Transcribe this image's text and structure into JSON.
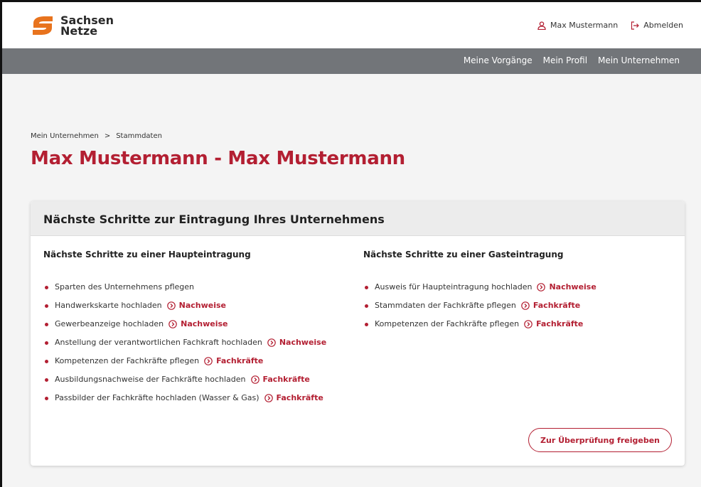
{
  "brand": {
    "line1": "Sachsen",
    "line2": "Netze",
    "colors": {
      "orange": "#e8731d",
      "red": "#b31f32"
    }
  },
  "user": {
    "name": "Max Mustermann",
    "logout": "Abmelden"
  },
  "nav": {
    "items": [
      "Meine Vorgänge",
      "Mein Profil",
      "Mein Unternehmen"
    ]
  },
  "breadcrumb": {
    "parent": "Mein Unternehmen",
    "separator": ">",
    "current": "Stammdaten"
  },
  "page": {
    "title": "Max Mustermann - Max Mustermann"
  },
  "card": {
    "title": "Nächste Schritte zur Eintragung Ihres Unternehmens",
    "left": {
      "heading": "Nächste Schritte zu einer Haupteintragung",
      "items": [
        {
          "text": "Sparten des Unternehmens pflegen",
          "link": ""
        },
        {
          "text": "Handwerkskarte hochladen",
          "link": "Nachweise"
        },
        {
          "text": "Gewerbeanzeige hochladen",
          "link": "Nachweise"
        },
        {
          "text": "Anstellung der verantwortlichen Fachkraft hochladen",
          "link": "Nachweise"
        },
        {
          "text": "Kompetenzen der Fachkräfte pflegen",
          "link": "Fachkräfte"
        },
        {
          "text": "Ausbildungsnachweise der Fachkräfte hochladen",
          "link": "Fachkräfte"
        },
        {
          "text": "Passbilder der Fachkräfte hochladen (Wasser & Gas)",
          "link": "Fachkräfte"
        }
      ]
    },
    "right": {
      "heading": "Nächste Schritte zu einer Gasteintragung",
      "items": [
        {
          "text": "Ausweis für Haupteintragung hochladen",
          "link": "Nachweise"
        },
        {
          "text": "Stammdaten der Fachkräfte pflegen",
          "link": "Fachkräfte"
        },
        {
          "text": "Kompetenzen der Fachkräfte pflegen",
          "link": "Fachkräfte"
        }
      ]
    },
    "submit": "Zur Überprüfung freigeben"
  }
}
